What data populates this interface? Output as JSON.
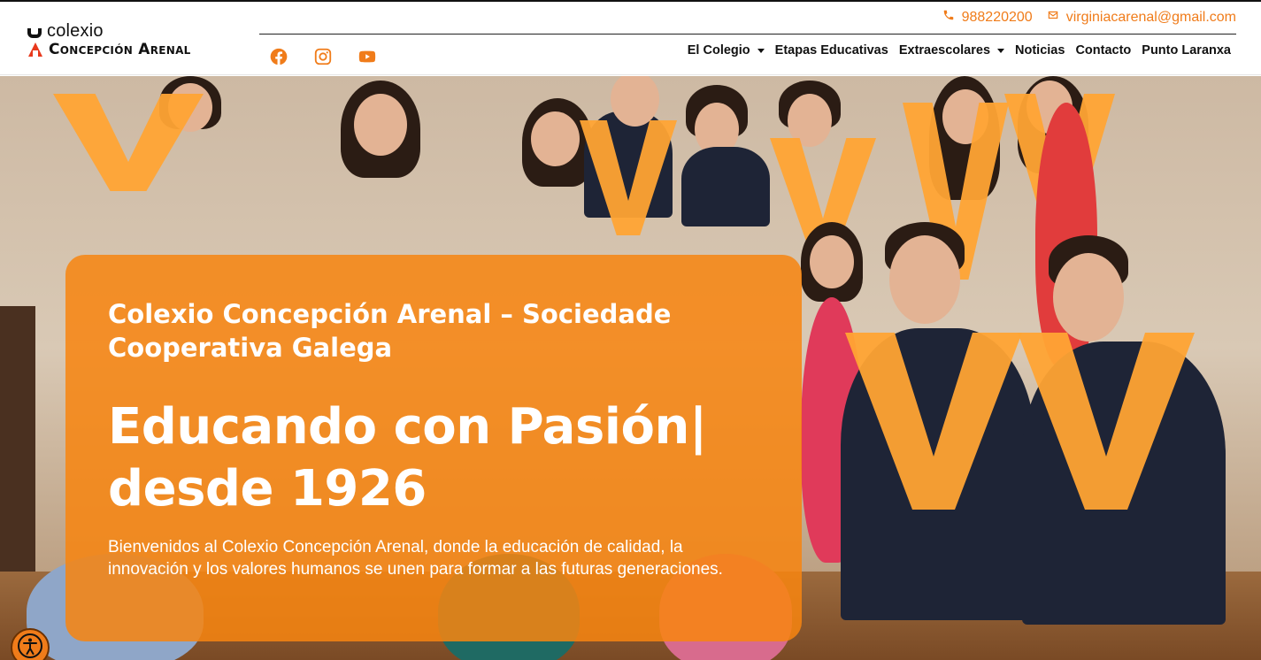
{
  "header": {
    "logo_top": "colexio",
    "logo_bottom": "Concepción Arenal",
    "phone": "988220200",
    "email": "virginiacarenal@gmail.com"
  },
  "social": [
    "facebook-icon",
    "instagram-icon",
    "youtube-icon"
  ],
  "nav": [
    {
      "label": "El Colegio",
      "dropdown": true
    },
    {
      "label": "Etapas Educativas",
      "dropdown": false
    },
    {
      "label": "Extraescolares",
      "dropdown": true
    },
    {
      "label": "Noticias",
      "dropdown": false
    },
    {
      "label": "Contacto",
      "dropdown": false
    },
    {
      "label": "Punto Laranxa",
      "dropdown": false
    }
  ],
  "hero": {
    "title_bold": "Colexio Concepción Arenal –",
    "title_rest": " Sociedade Cooperativa Galega",
    "headline": "Educando con Pasión| desde 1926",
    "text": "Bienvenidos al Colexio Concepción Arenal, donde la educación de calidad, la innovación y los valores humanos se unen para formar a las futuras generaciones."
  },
  "colors": {
    "accent": "#f07c1a",
    "overlay": "#f78510"
  }
}
